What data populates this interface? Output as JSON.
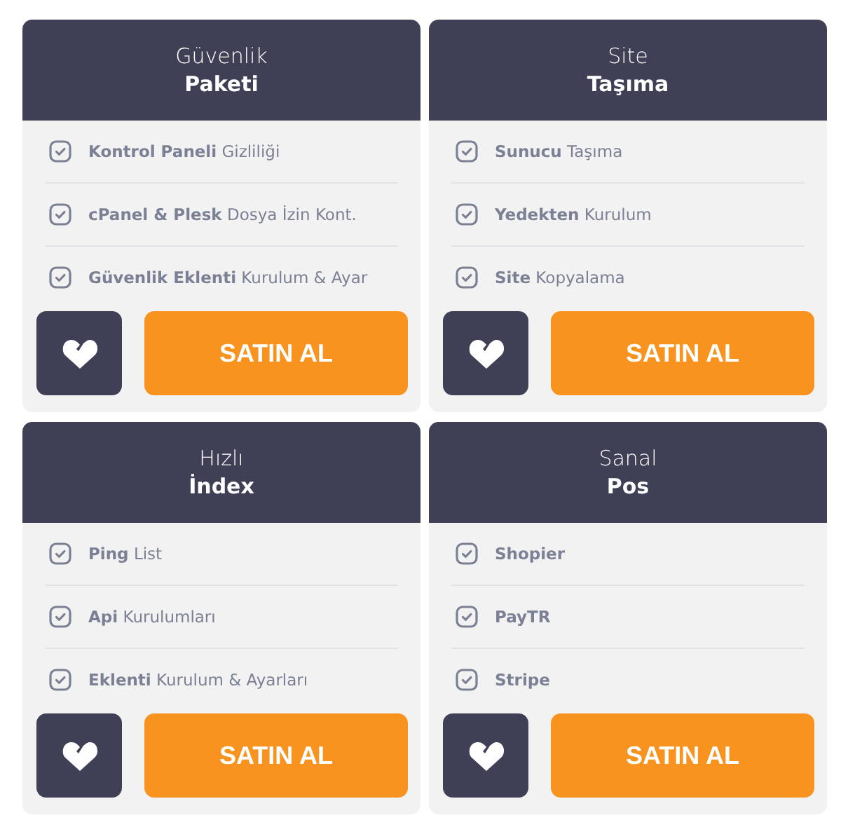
{
  "cards": [
    {
      "title": "Güvenlik",
      "subtitle": "Paketi",
      "features": [
        {
          "label": "**Kontrol Paneli** Gizliliği"
        },
        {
          "label": "**cPanel & Plesk** Dosya İzin Kont."
        },
        {
          "label": "**Güvenlik Eklenti** Kurulum & Ayar"
        }
      ],
      "button": "SATIN AL"
    },
    {
      "title": "Site",
      "subtitle": "Taşıma",
      "features": [
        {
          "label": "**Sunucu** Taşıma"
        },
        {
          "label": "**Yedekten** Kurulum"
        },
        {
          "label": "**Site** Kopyalama"
        }
      ],
      "button": "SATIN AL"
    },
    {
      "title": "Hızlı",
      "subtitle": "İndex",
      "features": [
        {
          "label": "**Ping** List"
        },
        {
          "label": "**Api** Kurulumları"
        },
        {
          "label": "**Eklenti** Kurulum & Ayarları"
        }
      ],
      "button": "SATIN AL"
    },
    {
      "title": "Sanal",
      "subtitle": "Pos",
      "features": [
        {
          "label": "Shopier",
          "bold": true
        },
        {
          "label": "PayTR",
          "bold": true
        },
        {
          "label": "Stripe",
          "bold": true
        }
      ],
      "button": "SATIN AL"
    }
  ]
}
